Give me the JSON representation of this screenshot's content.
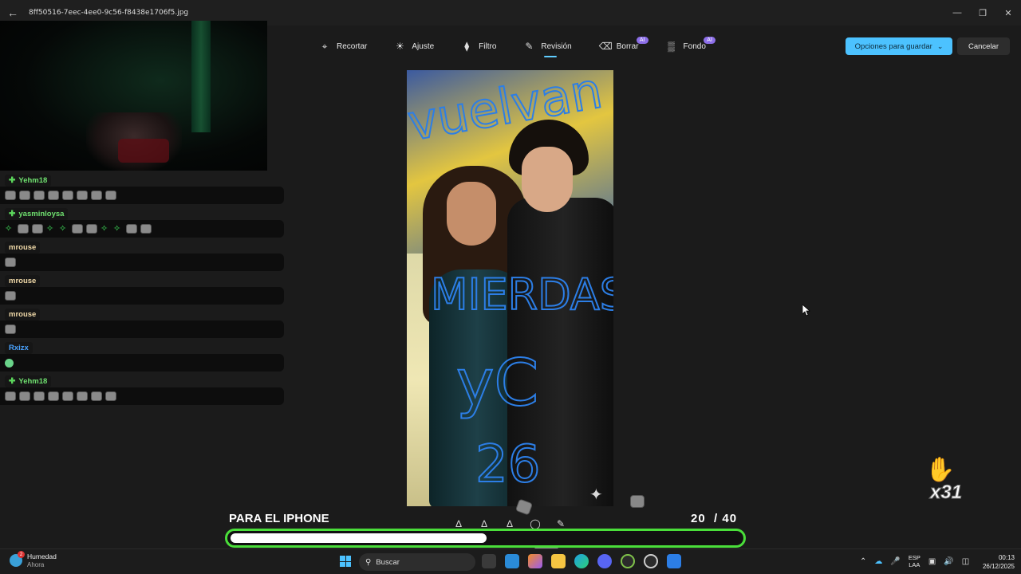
{
  "window": {
    "filename": "8ff50516-7eec-4ee0-9c56-f8438e1706f5.jpg"
  },
  "toolbar": {
    "tools": [
      {
        "label": "Recortar",
        "icon": "crop-icon",
        "ai": false,
        "active": false
      },
      {
        "label": "Ajuste",
        "icon": "brightness-icon",
        "ai": false,
        "active": false
      },
      {
        "label": "Filtro",
        "icon": "filter-icon",
        "ai": false,
        "active": false
      },
      {
        "label": "Revisión",
        "icon": "pen-icon",
        "ai": false,
        "active": true
      },
      {
        "label": "Borrar",
        "icon": "eraser-icon",
        "ai": true,
        "active": false
      },
      {
        "label": "Fondo",
        "icon": "background-icon",
        "ai": true,
        "active": false
      }
    ],
    "ai_badge": "AI",
    "save_label": "Opciones para guardar",
    "cancel_label": "Cancelar"
  },
  "chat": {
    "messages": [
      {
        "user": "Yehm18",
        "color": "#6fe06f",
        "badge": true,
        "emotes": [
          "cat",
          "cat",
          "cat",
          "cat",
          "cat",
          "cat",
          "cat",
          "cat"
        ]
      },
      {
        "user": "yasminloysa",
        "color": "#6fe06f",
        "badge": true,
        "emotes": [
          "leaf",
          "cat",
          "cat",
          "leaf",
          "leaf",
          "cat",
          "cat",
          "leaf",
          "leaf",
          "cat",
          "cat"
        ]
      },
      {
        "user": "mrouse",
        "color": "#f0d9a8",
        "badge": false,
        "emotes": [
          "cat"
        ]
      },
      {
        "user": "mrouse",
        "color": "#f0d9a8",
        "badge": false,
        "emotes": [
          "cat"
        ]
      },
      {
        "user": "mrouse",
        "color": "#f0d9a8",
        "badge": false,
        "emotes": [
          "cat"
        ]
      },
      {
        "user": "Rxizx",
        "color": "#4aa3ff",
        "badge": false,
        "emotes": [
          "gem"
        ]
      },
      {
        "user": "Yehm18",
        "color": "#6fe06f",
        "badge": true,
        "emotes": [
          "cat",
          "cat",
          "cat",
          "cat",
          "cat",
          "cat",
          "cat",
          "cat"
        ]
      }
    ]
  },
  "photo": {
    "handwriting": [
      "vuelvan",
      "MIERDAS",
      "yC",
      "26"
    ]
  },
  "goal": {
    "label": "PARA EL IPHONE",
    "current": "20",
    "total": "/ 40",
    "progress": 0.5,
    "color": "#4ade3a"
  },
  "alert": {
    "multiplier": "x31"
  },
  "taskbar": {
    "weather_title": "Humedad",
    "weather_sub": "Ahora",
    "weather_badge": "2",
    "search_placeholder": "Buscar",
    "lang_top": "ESP",
    "lang_bottom": "LAA",
    "time": "00:13",
    "date": "26/12/2025"
  },
  "colors": {
    "accent": "#4cc2ff",
    "ai": "#8c6ee8"
  }
}
